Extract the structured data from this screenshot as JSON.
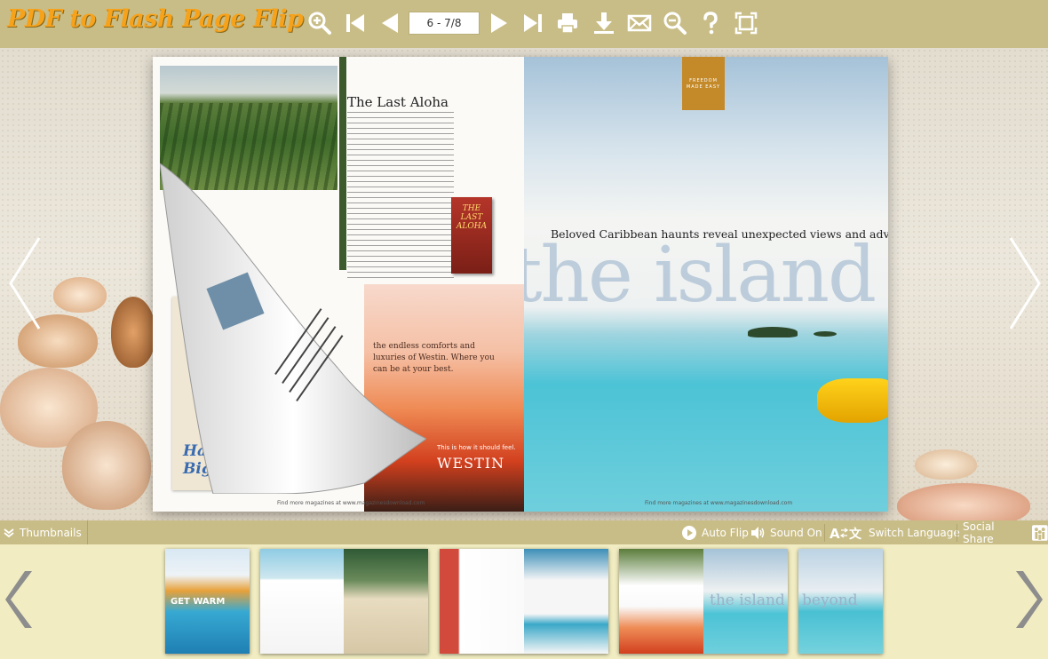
{
  "app": {
    "logo_text": "PDF to Flash Page Flip"
  },
  "toolbar": {
    "page_value": "6 - 7/8",
    "buttons": [
      {
        "name": "zoom-in",
        "icon": "zoom-in-icon"
      },
      {
        "name": "first-page",
        "icon": "first-page-icon"
      },
      {
        "name": "previous-page",
        "icon": "previous-page-icon"
      },
      {
        "name": "next-page",
        "icon": "next-page-icon"
      },
      {
        "name": "last-page",
        "icon": "last-page-icon"
      },
      {
        "name": "print",
        "icon": "print-icon"
      },
      {
        "name": "download",
        "icon": "download-icon"
      },
      {
        "name": "email",
        "icon": "email-icon"
      },
      {
        "name": "search",
        "icon": "search-icon"
      },
      {
        "name": "help",
        "icon": "help-icon"
      },
      {
        "name": "fullscreen",
        "icon": "fullscreen-icon"
      }
    ]
  },
  "book": {
    "left_page": {
      "article_title": "The Last Aloha",
      "book_cover_title": "THE LAST ALOHA",
      "sunset_text": "the endless comforts and luxuries of Westin. Where you can be at your best.",
      "westin_tagline": "This is how it should feel.",
      "westin_logo": "WESTIN",
      "hawaii_logo": "Hawai'i Big Island",
      "footer": "Find more magazines at www.magazinesdownload.com"
    },
    "right_page": {
      "emblem_text": "FREEDOM MADE EASY",
      "tagline": "Beloved Caribbean haunts reveal unexpected views and adventure.",
      "big_title": "the island",
      "footer": "Find more magazines at www.magazinesdownload.com"
    }
  },
  "controls": {
    "thumbnails_label": "Thumbnails",
    "auto_flip_label": "Auto Flip",
    "sound_label": "Sound On",
    "switch_language_label": "Switch Language",
    "social_share_label": "Social Share"
  },
  "thumbnails": [
    {
      "pages": "1",
      "label": "GET WARM"
    },
    {
      "pages": "2-3"
    },
    {
      "pages": "4-5"
    },
    {
      "pages": "6-7",
      "label": "the island",
      "current": true
    },
    {
      "pages": "8",
      "label": "beyond"
    }
  ],
  "colors": {
    "toolbar_bg": "#c9bd87",
    "strip_bg": "#f1ecc1",
    "logo": "#f7a21b"
  }
}
